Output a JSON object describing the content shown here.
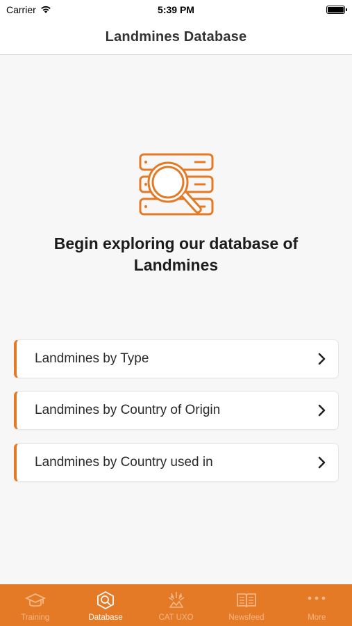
{
  "status_bar": {
    "carrier": "Carrier",
    "time": "5:39 PM"
  },
  "header": {
    "title": "Landmines Database"
  },
  "main": {
    "hero_text": "Begin exploring our database of Landmines",
    "hero_icon": "database-search-icon",
    "items": [
      {
        "label": "Landmines by Type"
      },
      {
        "label": "Landmines by Country of Origin"
      },
      {
        "label": "Landmines by Country used in"
      }
    ]
  },
  "tab_bar": {
    "tabs": [
      {
        "label": "Training",
        "icon": "graduation-cap-icon",
        "active": false
      },
      {
        "label": "Database",
        "icon": "database-search-icon",
        "active": true
      },
      {
        "label": "CAT UXO",
        "icon": "explosion-icon",
        "active": false
      },
      {
        "label": "Newsfeed",
        "icon": "book-icon",
        "active": false
      },
      {
        "label": "More",
        "icon": "more-dots-icon",
        "active": false
      }
    ]
  },
  "colors": {
    "accent": "#e47a25",
    "tab_inactive": "#f5b787",
    "background": "#f7f7f7"
  }
}
